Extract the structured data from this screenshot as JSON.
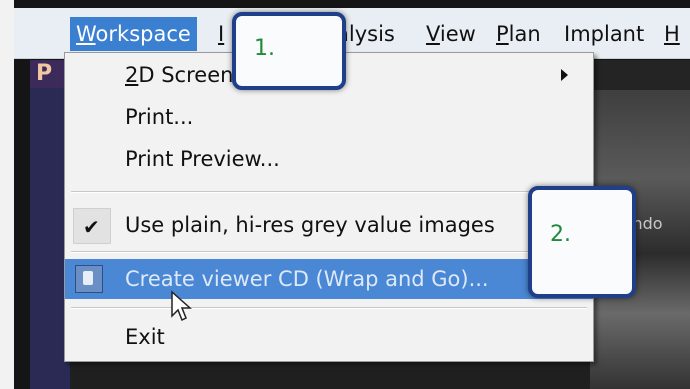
{
  "menubar": {
    "items": [
      {
        "label": "Workspace",
        "accel": "W",
        "rest": "orkspace",
        "active": true
      },
      {
        "label": "Image",
        "accel": "I",
        "rest": "",
        "active": false
      },
      {
        "label": "Analysis",
        "accel": "",
        "rest": "alysis",
        "active": false
      },
      {
        "label": "View",
        "accel": "V",
        "rest": "iew",
        "active": false
      },
      {
        "label": "Plan",
        "accel": "P",
        "rest": "lan",
        "active": false
      },
      {
        "label": "Implant",
        "accel": "",
        "rest": "Implant",
        "active": false
      },
      {
        "label": "Help",
        "accel": "H",
        "rest": "",
        "active": false
      }
    ]
  },
  "panel": {
    "tab_text": "P"
  },
  "dropdown": {
    "items": {
      "screenshot": {
        "prefix": "2",
        "label": "D Screenshot",
        "has_submenu": true
      },
      "print": {
        "label": "Print..."
      },
      "print_preview": {
        "label": "Print Preview..."
      },
      "grey_values": {
        "label": "Use plain, hi-res grey value images",
        "checked": true
      },
      "wrap_and_go": {
        "label": "Create viewer CD (Wrap and Go)...",
        "highlighted": true
      },
      "exit": {
        "label": "Exit"
      }
    }
  },
  "callouts": {
    "one": "1.",
    "two": "2."
  },
  "viewer": {
    "label_fragment": "indo"
  },
  "colors": {
    "menu_active": "#3b7fd0",
    "item_highlight": "#4a87d4",
    "callout_border": "#1f3f8a",
    "callout_text": "#1f8a3a"
  }
}
